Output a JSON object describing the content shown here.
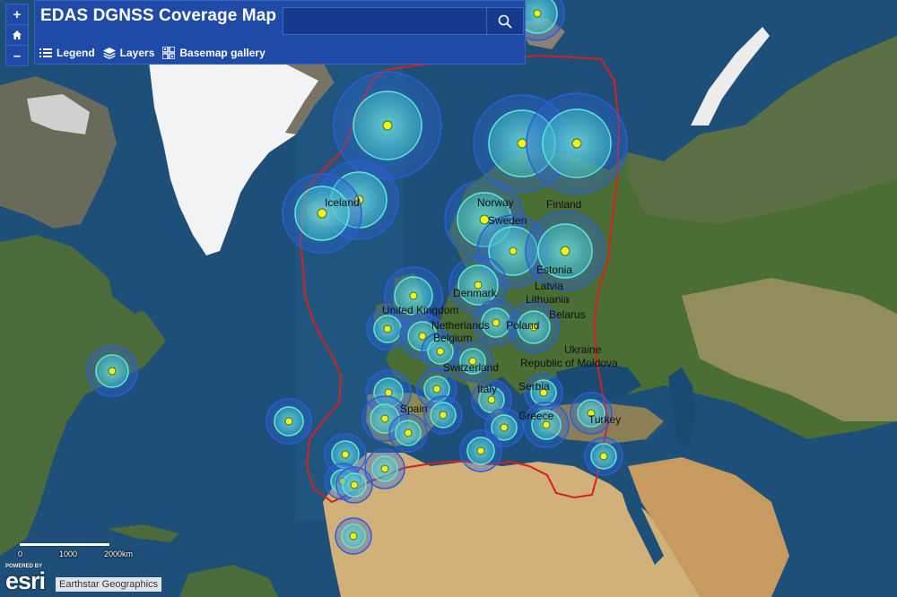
{
  "header": {
    "title": "EDAS DGNSS Coverage Map",
    "search_placeholder": ""
  },
  "toolbar": {
    "legend_label": "Legend",
    "layers_label": "Layers",
    "basemap_label": "Basemap gallery"
  },
  "zoom": {
    "in_label": "+",
    "home_icon": "home-icon",
    "out_label": "–"
  },
  "scalebar": {
    "ticks": [
      "0",
      "1000",
      "2000km"
    ]
  },
  "attribution": {
    "powered_by": "POWERED BY",
    "esri": "esri",
    "text": "Earthstar Geographics"
  },
  "colors": {
    "ocean": "#1d4f78",
    "land_green": "#4a6e34",
    "desert": "#c9a46a",
    "ice": "#f2f4f6",
    "boundary": "#d62020",
    "ring_outer": "#2a5fd6",
    "ring_inner": "#5fe8d6",
    "station": "#f2f21a",
    "header": "#1f4aa8"
  },
  "country_labels": [
    "Iceland",
    "Norway",
    "Finland",
    "Sweden",
    "Estonia",
    "Denmark",
    "Latvia",
    "Lithuania",
    "United Kingdom",
    "Belarus",
    "Netherlands",
    "Poland",
    "Belgium",
    "Ukraine",
    "Republic of Moldova",
    "Switzerland",
    "Italy",
    "Serbia",
    "Spain",
    "Greece",
    "Turkey"
  ],
  "stations": [
    {
      "id": "s1"
    },
    {
      "id": "s2"
    },
    {
      "id": "s3"
    },
    {
      "id": "s4"
    },
    {
      "id": "s5"
    },
    {
      "id": "s6"
    },
    {
      "id": "s7"
    },
    {
      "id": "s8"
    },
    {
      "id": "s9"
    },
    {
      "id": "s10"
    },
    {
      "id": "s11"
    },
    {
      "id": "s12"
    },
    {
      "id": "s13"
    },
    {
      "id": "s14"
    },
    {
      "id": "s15"
    },
    {
      "id": "s16"
    },
    {
      "id": "s17"
    },
    {
      "id": "s18"
    },
    {
      "id": "s19"
    },
    {
      "id": "s20"
    },
    {
      "id": "s21"
    },
    {
      "id": "s22"
    },
    {
      "id": "s23"
    },
    {
      "id": "s24"
    },
    {
      "id": "s25"
    },
    {
      "id": "s26"
    },
    {
      "id": "s27"
    },
    {
      "id": "s28"
    },
    {
      "id": "s29"
    },
    {
      "id": "s30"
    },
    {
      "id": "s31"
    },
    {
      "id": "s32"
    },
    {
      "id": "s33"
    },
    {
      "id": "s34"
    },
    {
      "id": "s35"
    },
    {
      "id": "s36"
    },
    {
      "id": "s37"
    },
    {
      "id": "s38"
    },
    {
      "id": "s39"
    }
  ]
}
